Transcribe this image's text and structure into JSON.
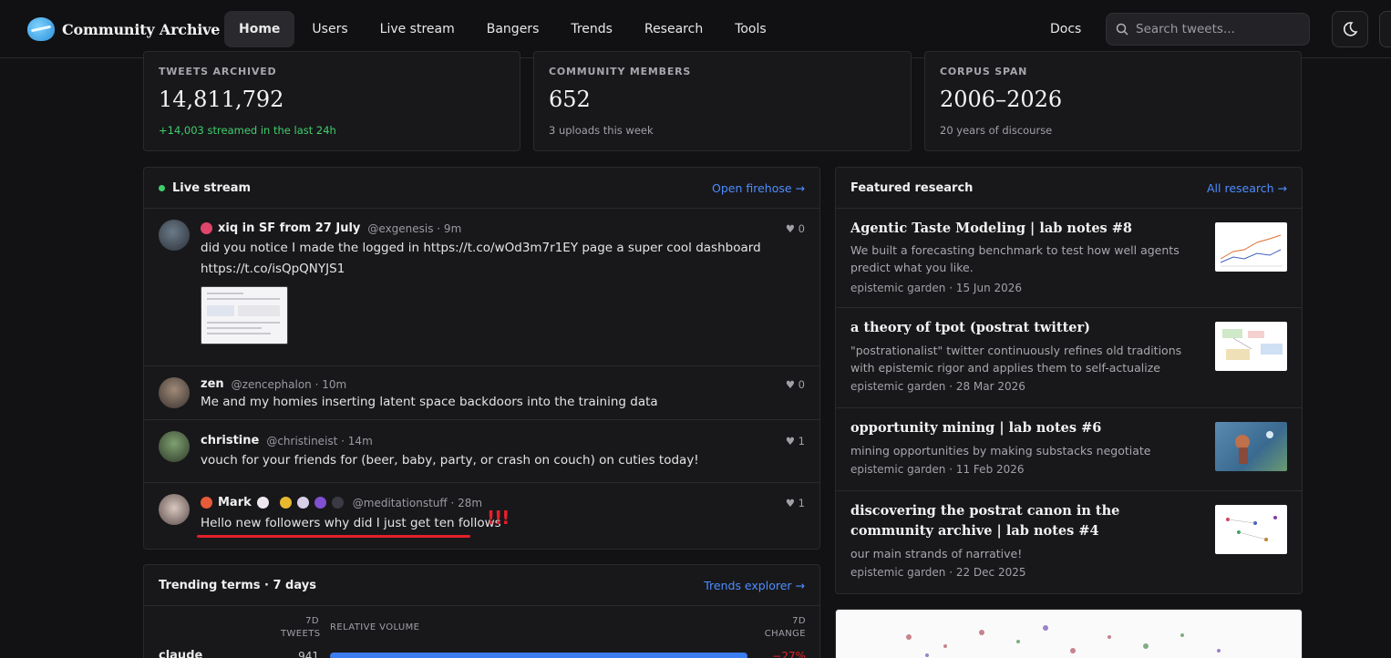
{
  "nav": {
    "logo_text": "Community Archive",
    "links": [
      "Home",
      "Users",
      "Live stream",
      "Bangers",
      "Trends",
      "Research",
      "Tools"
    ],
    "docs": "Docs",
    "search_placeholder": "Search tweets..."
  },
  "stats": [
    {
      "label": "TWEETS ARCHIVED",
      "value": "14,811,792",
      "sub": "+14,003 streamed in the last 24h"
    },
    {
      "label": "COMMUNITY MEMBERS",
      "value": "652",
      "sub": "3 uploads this week"
    },
    {
      "label": "CORPUS SPAN",
      "value": "2006–2026",
      "sub": "20 years of discourse"
    }
  ],
  "live": {
    "title": "Live stream",
    "link": "Open firehose →",
    "tweets": [
      {
        "name": "xiq in SF from 27 July",
        "meta": "@exgenesis · 9m",
        "text": "did you notice I made the logged in https://t.co/wOd3m7r1EY page a super cool dashboard https://t.co/isQpQNYJS1",
        "likes": "♥ 0"
      },
      {
        "name": "zen",
        "meta": "@zencephalon · 10m",
        "text": "Me and my homies inserting latent space backdoors into the training data",
        "likes": "♥ 0"
      },
      {
        "name": "christine",
        "meta": "@christineist · 14m",
        "text": "vouch for your friends for (beer, baby, party, or crash on couch) on cuties today!",
        "likes": "♥ 1"
      },
      {
        "name": "Mark",
        "meta": "@meditationstuff · 28m",
        "text": "Hello new followers why did I just get ten follows",
        "likes": "♥ 1"
      }
    ],
    "annotation": "!!!"
  },
  "research": {
    "title": "Featured research",
    "link": "All research →",
    "items": [
      {
        "title": "Agentic Taste Modeling | lab notes #8",
        "desc": "We built a forecasting benchmark to test how well agents predict what you like.",
        "meta": "epistemic garden · 15 Jun 2026"
      },
      {
        "title": "a theory of tpot (postrat twitter)",
        "desc": "\"postrationalist\" twitter continuously refines old traditions with epistemic rigor and applies them to self-actualize",
        "meta": "epistemic garden · 28 Mar 2026"
      },
      {
        "title": "opportunity mining | lab notes #6",
        "desc": "mining opportunities by making substacks negotiate",
        "meta": "epistemic garden · 11 Feb 2026"
      },
      {
        "title": "discovering the postrat canon in the community archive | lab notes #4",
        "desc": "our main strands of narrative!",
        "meta": "epistemic garden · 22 Dec 2025"
      }
    ]
  },
  "trending": {
    "title": "Trending terms · 7 days",
    "link": "Trends explorer →",
    "col_tweets_1": "7D",
    "col_tweets_2": "TWEETS",
    "col_volume": "RELATIVE VOLUME",
    "col_change_1": "7D",
    "col_change_2": "CHANGE",
    "rows": [
      {
        "term": "claude",
        "tweets": "941",
        "change": "−27%",
        "volume": 1.0
      }
    ]
  },
  "colors": {
    "accent": "#4d8dff",
    "live": "#3fcf6a",
    "negative": "#e3202a",
    "bar": "#3b7cf0"
  }
}
